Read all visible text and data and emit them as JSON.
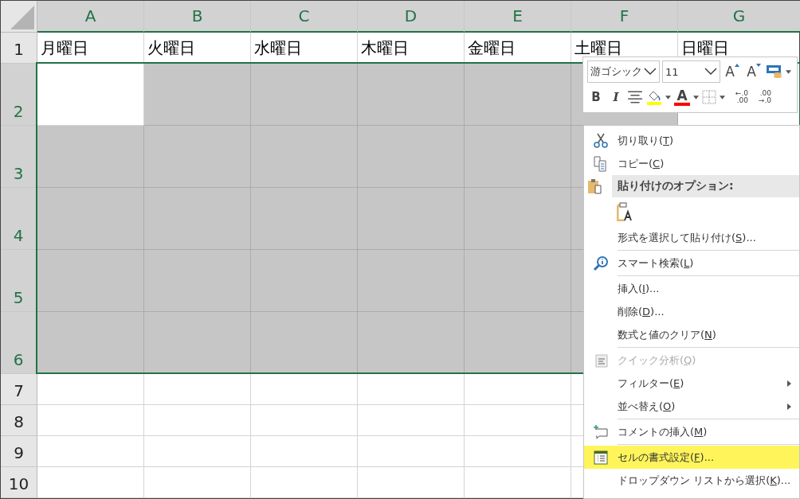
{
  "columns": [
    {
      "label": "A",
      "selected": true
    },
    {
      "label": "B",
      "selected": true
    },
    {
      "label": "C",
      "selected": true
    },
    {
      "label": "D",
      "selected": true
    },
    {
      "label": "E",
      "selected": true
    },
    {
      "label": "F",
      "selected": true
    },
    {
      "label": "G",
      "selected": true
    }
  ],
  "rows": [
    {
      "label": "1",
      "selected": false,
      "cells": [
        "月曜日",
        "火曜日",
        "水曜日",
        "木曜日",
        "金曜日",
        "土曜日",
        "日曜日"
      ]
    },
    {
      "label": "2",
      "selected": true,
      "cells": [
        {
          "selected": false
        },
        {
          "selected": true
        },
        {
          "selected": true
        },
        {
          "selected": true
        },
        {
          "selected": true
        },
        {
          "selected": true
        }
      ]
    },
    {
      "label": "3",
      "selected": true,
      "cells": [
        {
          "selected": true
        },
        {
          "selected": true
        },
        {
          "selected": true
        },
        {
          "selected": true
        },
        {
          "selected": true
        },
        {
          "selected": true
        }
      ]
    },
    {
      "label": "4",
      "selected": true,
      "cells": [
        {
          "selected": true
        },
        {
          "selected": true
        },
        {
          "selected": true
        },
        {
          "selected": true
        },
        {
          "selected": true
        },
        {
          "selected": true
        }
      ]
    },
    {
      "label": "5",
      "selected": true,
      "cells": [
        {
          "selected": true
        },
        {
          "selected": true
        },
        {
          "selected": true
        },
        {
          "selected": true
        },
        {
          "selected": true
        },
        {
          "selected": true
        }
      ]
    },
    {
      "label": "6",
      "selected": true,
      "cells": [
        {
          "selected": true
        },
        {
          "selected": true
        },
        {
          "selected": true
        },
        {
          "selected": true
        },
        {
          "selected": true
        },
        {
          "selected": true
        }
      ]
    },
    {
      "label": "7",
      "selected": false,
      "cells": []
    },
    {
      "label": "8",
      "selected": false,
      "cells": []
    },
    {
      "label": "9",
      "selected": false,
      "cells": []
    },
    {
      "label": "10",
      "selected": false,
      "cells": []
    }
  ],
  "mini_toolbar": {
    "font": "游ゴシック",
    "size": "11",
    "grow_label": "A",
    "shrink_label": "A",
    "bold_label": "B",
    "italic_label": "I",
    "fill": {
      "color": "#ffff00"
    },
    "font_color_label": "A",
    "font_color": {
      "color": "#ff0000"
    },
    "increase_decimal": {
      "top": "←.0",
      "bottom": ".00"
    },
    "decrease_decimal": {
      "top": ".00",
      "bottom": "→.0"
    }
  },
  "context_menu": [
    {
      "kind": "item",
      "label": "切り取り(",
      "key": "T",
      "tail": ")",
      "disabled": false,
      "submenu": false,
      "selected": false
    },
    {
      "kind": "item",
      "label": "コピー(",
      "key": "C",
      "tail": ")",
      "disabled": false,
      "submenu": false,
      "selected": false
    },
    {
      "kind": "header",
      "label": "貼り付けのオプション:"
    },
    {
      "kind": "paste-options"
    },
    {
      "kind": "item",
      "label": "形式を選択して貼り付け(",
      "key": "S",
      "tail": ")...",
      "disabled": false,
      "submenu": false,
      "selected": false
    },
    {
      "kind": "separator"
    },
    {
      "kind": "item",
      "label": "スマート検索(",
      "key": "L",
      "tail": ")",
      "disabled": false,
      "submenu": false,
      "selected": false
    },
    {
      "kind": "separator"
    },
    {
      "kind": "item",
      "label": "挿入(",
      "key": "I",
      "tail": ")...",
      "disabled": false,
      "submenu": false,
      "selected": false
    },
    {
      "kind": "item",
      "label": "削除(",
      "key": "D",
      "tail": ")...",
      "disabled": false,
      "submenu": false,
      "selected": false
    },
    {
      "kind": "item",
      "label": "数式と値のクリア(",
      "key": "N",
      "tail": ")",
      "disabled": false,
      "submenu": false,
      "selected": false
    },
    {
      "kind": "separator"
    },
    {
      "kind": "item",
      "label": "クイック分析(",
      "key": "Q",
      "tail": ")",
      "disabled": true,
      "submenu": false,
      "selected": false
    },
    {
      "kind": "item",
      "label": "フィルター(",
      "key": "E",
      "tail": ")",
      "disabled": false,
      "submenu": true,
      "selected": false
    },
    {
      "kind": "item",
      "label": "並べ替え(",
      "key": "O",
      "tail": ")",
      "disabled": false,
      "submenu": true,
      "selected": false
    },
    {
      "kind": "separator"
    },
    {
      "kind": "item",
      "label": "コメントの挿入(",
      "key": "M",
      "tail": ")",
      "disabled": false,
      "submenu": false,
      "selected": false
    },
    {
      "kind": "separator"
    },
    {
      "kind": "item",
      "label": "セルの書式設定(",
      "key": "F",
      "tail": ")...",
      "disabled": false,
      "submenu": false,
      "selected": true
    },
    {
      "kind": "item",
      "label": "ドロップダウン リストから選択(",
      "key": "K",
      "tail": ")...",
      "disabled": false,
      "submenu": false,
      "selected": false
    }
  ]
}
